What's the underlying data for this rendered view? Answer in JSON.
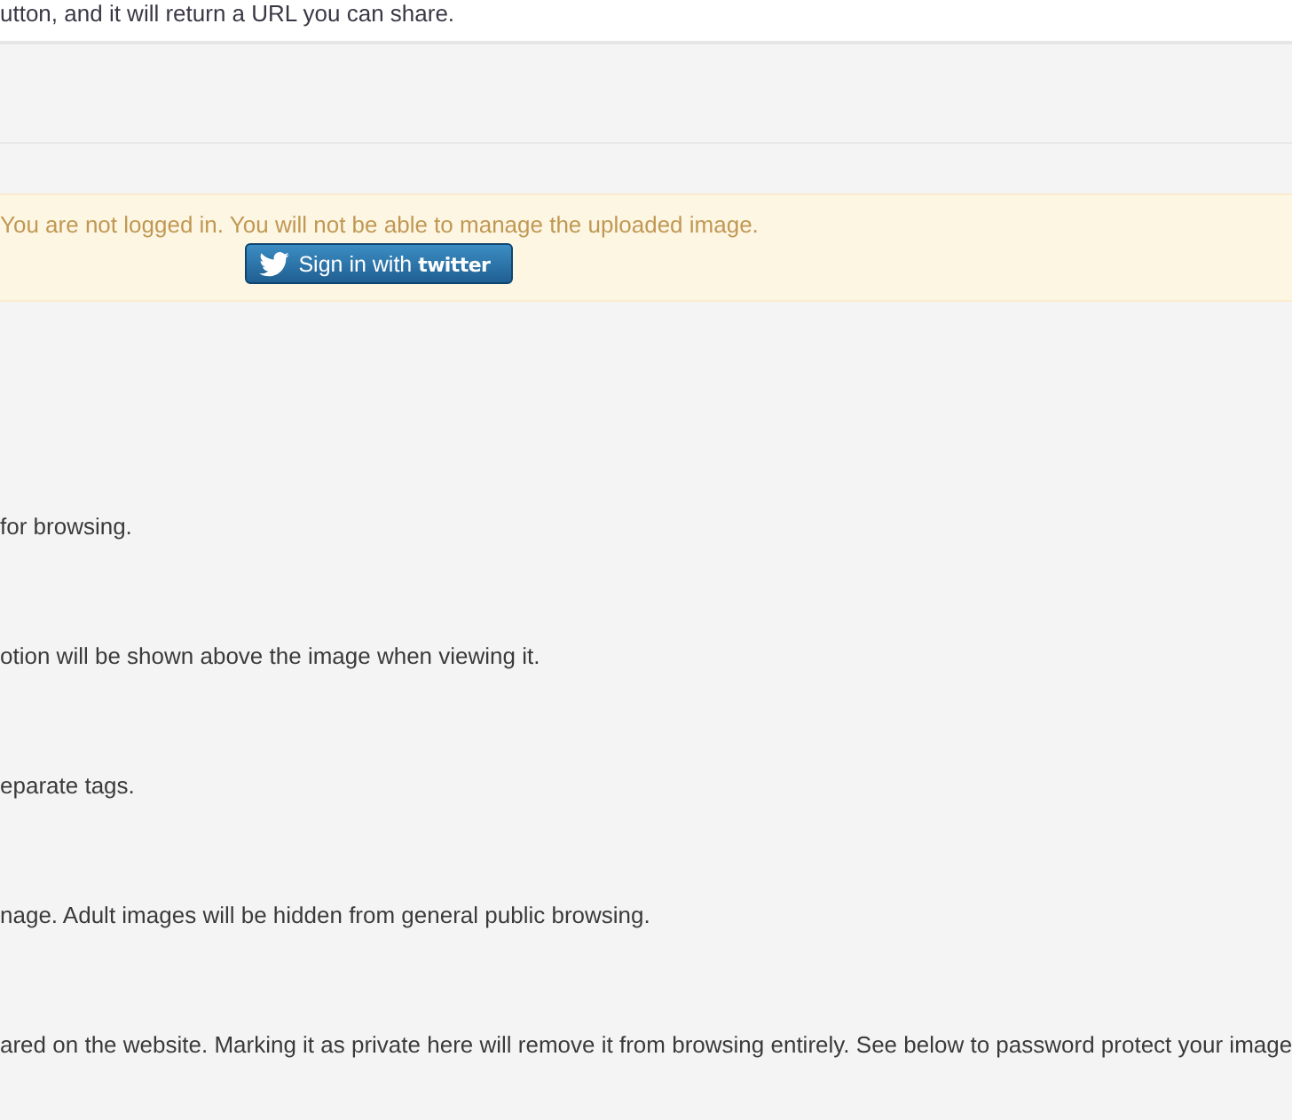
{
  "intro": {
    "text": "utton, and it will return a URL you can share."
  },
  "login_alert": {
    "message": "You are not logged in. You will not be able to manage the uploaded image.",
    "button": {
      "label": "Sign in with **twitter**"
    }
  },
  "help_texts": [
    "for browsing.",
    "otion will be shown above the image when viewing it.",
    "eparate tags.",
    "nage. Adult images will be hidden from general public browsing.",
    "ared on the website. Marking it as private here will remove it from browsing entirely. See below to password protect your image"
  ]
}
